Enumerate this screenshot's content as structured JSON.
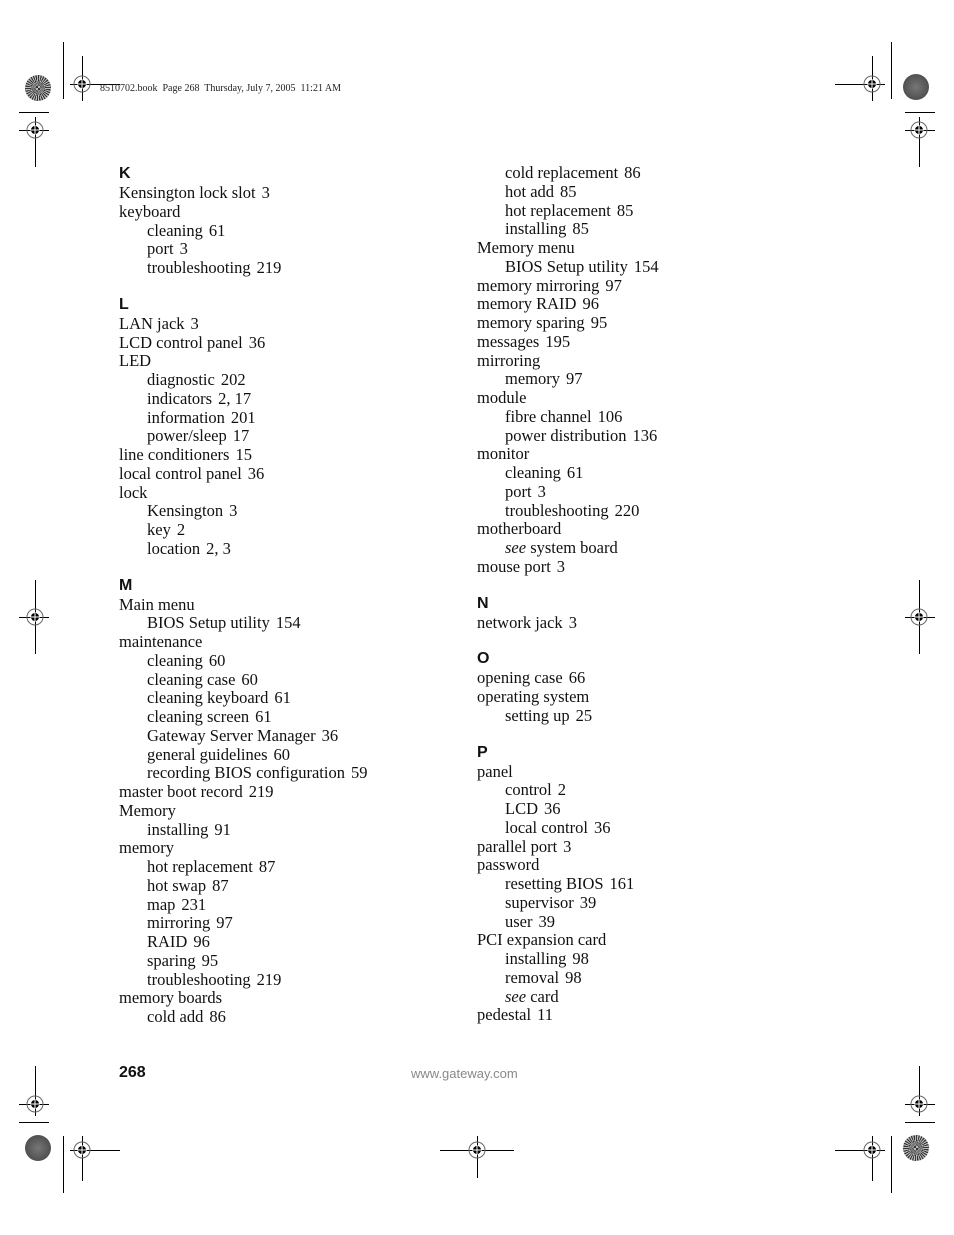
{
  "header": {
    "slug": "8510702.book  Page 268  Thursday, July 7, 2005  11:21 AM"
  },
  "left_column": [
    {
      "type": "letter",
      "text": "K"
    },
    {
      "type": "main",
      "text": "Kensington lock slot",
      "page": "3"
    },
    {
      "type": "main",
      "text": "keyboard",
      "page": ""
    },
    {
      "type": "sub",
      "text": "cleaning",
      "page": "61"
    },
    {
      "type": "sub",
      "text": "port",
      "page": "3"
    },
    {
      "type": "sub",
      "text": "troubleshooting",
      "page": "219"
    },
    {
      "type": "letter",
      "text": "L"
    },
    {
      "type": "main",
      "text": "LAN jack",
      "page": "3"
    },
    {
      "type": "main",
      "text": "LCD control panel",
      "page": "36"
    },
    {
      "type": "main",
      "text": "LED",
      "page": ""
    },
    {
      "type": "sub",
      "text": "diagnostic",
      "page": "202"
    },
    {
      "type": "sub",
      "text": "indicators",
      "page": "2, 17"
    },
    {
      "type": "sub",
      "text": "information",
      "page": "201"
    },
    {
      "type": "sub",
      "text": "power/sleep",
      "page": "17"
    },
    {
      "type": "main",
      "text": "line conditioners",
      "page": "15"
    },
    {
      "type": "main",
      "text": "local control panel",
      "page": "36"
    },
    {
      "type": "main",
      "text": "lock",
      "page": ""
    },
    {
      "type": "sub",
      "text": "Kensington",
      "page": "3"
    },
    {
      "type": "sub",
      "text": "key",
      "page": "2"
    },
    {
      "type": "sub",
      "text": "location",
      "page": "2, 3"
    },
    {
      "type": "letter",
      "text": "M"
    },
    {
      "type": "main",
      "text": "Main menu",
      "page": ""
    },
    {
      "type": "sub",
      "text": "BIOS Setup utility",
      "page": "154"
    },
    {
      "type": "main",
      "text": "maintenance",
      "page": ""
    },
    {
      "type": "sub",
      "text": "cleaning",
      "page": "60"
    },
    {
      "type": "sub",
      "text": "cleaning case",
      "page": "60"
    },
    {
      "type": "sub",
      "text": "cleaning keyboard",
      "page": "61"
    },
    {
      "type": "sub",
      "text": "cleaning screen",
      "page": "61"
    },
    {
      "type": "sub",
      "text": "Gateway Server Manager",
      "page": "36"
    },
    {
      "type": "sub",
      "text": "general guidelines",
      "page": "60"
    },
    {
      "type": "sub",
      "text": "recording BIOS configuration",
      "page": "59"
    },
    {
      "type": "main",
      "text": "master boot record",
      "page": "219"
    },
    {
      "type": "main",
      "text": "Memory",
      "page": ""
    },
    {
      "type": "sub",
      "text": "installing",
      "page": "91"
    },
    {
      "type": "main",
      "text": "memory",
      "page": ""
    },
    {
      "type": "sub",
      "text": "hot replacement",
      "page": "87"
    },
    {
      "type": "sub",
      "text": "hot swap",
      "page": "87"
    },
    {
      "type": "sub",
      "text": "map",
      "page": "231"
    },
    {
      "type": "sub",
      "text": "mirroring",
      "page": "97"
    },
    {
      "type": "sub",
      "text": "RAID",
      "page": "96"
    },
    {
      "type": "sub",
      "text": "sparing",
      "page": "95"
    },
    {
      "type": "sub",
      "text": "troubleshooting",
      "page": "219"
    },
    {
      "type": "main",
      "text": "memory boards",
      "page": ""
    },
    {
      "type": "sub",
      "text": "cold add",
      "page": "86"
    }
  ],
  "right_column": [
    {
      "type": "sub",
      "text": "cold replacement",
      "page": "86"
    },
    {
      "type": "sub",
      "text": "hot add",
      "page": "85"
    },
    {
      "type": "sub",
      "text": "hot replacement",
      "page": "85"
    },
    {
      "type": "sub",
      "text": "installing",
      "page": "85"
    },
    {
      "type": "main",
      "text": "Memory menu",
      "page": ""
    },
    {
      "type": "sub",
      "text": "BIOS Setup utility",
      "page": "154"
    },
    {
      "type": "main",
      "text": "memory mirroring",
      "page": "97"
    },
    {
      "type": "main",
      "text": "memory RAID",
      "page": "96"
    },
    {
      "type": "main",
      "text": "memory sparing",
      "page": "95"
    },
    {
      "type": "main",
      "text": "messages",
      "page": "195"
    },
    {
      "type": "main",
      "text": "mirroring",
      "page": ""
    },
    {
      "type": "sub",
      "text": "memory",
      "page": "97"
    },
    {
      "type": "main",
      "text": "module",
      "page": ""
    },
    {
      "type": "sub",
      "text": "fibre channel",
      "page": "106"
    },
    {
      "type": "sub",
      "text": "power distribution",
      "page": "136"
    },
    {
      "type": "main",
      "text": "monitor",
      "page": ""
    },
    {
      "type": "sub",
      "text": "cleaning",
      "page": "61"
    },
    {
      "type": "sub",
      "text": "port",
      "page": "3"
    },
    {
      "type": "sub",
      "text": "troubleshooting",
      "page": "220"
    },
    {
      "type": "main",
      "text": "motherboard",
      "page": ""
    },
    {
      "type": "sub",
      "see": "see",
      "text": "system board",
      "page": ""
    },
    {
      "type": "main",
      "text": "mouse port",
      "page": "3"
    },
    {
      "type": "letter",
      "text": "N"
    },
    {
      "type": "main",
      "text": "network jack",
      "page": "3"
    },
    {
      "type": "letter",
      "text": "O"
    },
    {
      "type": "main",
      "text": "opening case",
      "page": "66"
    },
    {
      "type": "main",
      "text": "operating system",
      "page": ""
    },
    {
      "type": "sub",
      "text": "setting up",
      "page": "25"
    },
    {
      "type": "letter",
      "text": "P"
    },
    {
      "type": "main",
      "text": "panel",
      "page": ""
    },
    {
      "type": "sub",
      "text": "control",
      "page": "2"
    },
    {
      "type": "sub",
      "text": "LCD",
      "page": "36"
    },
    {
      "type": "sub",
      "text": "local control",
      "page": "36"
    },
    {
      "type": "main",
      "text": "parallel port",
      "page": "3"
    },
    {
      "type": "main",
      "text": "password",
      "page": ""
    },
    {
      "type": "sub",
      "text": "resetting BIOS",
      "page": "161"
    },
    {
      "type": "sub",
      "text": "supervisor",
      "page": "39"
    },
    {
      "type": "sub",
      "text": "user",
      "page": "39"
    },
    {
      "type": "main",
      "text": "PCI expansion card",
      "page": ""
    },
    {
      "type": "sub",
      "text": "installing",
      "page": "98"
    },
    {
      "type": "sub",
      "text": "removal",
      "page": "98"
    },
    {
      "type": "sub",
      "see": "see",
      "text": "card",
      "page": ""
    },
    {
      "type": "main",
      "text": "pedestal",
      "page": "11"
    }
  ],
  "footer": {
    "page_number": "268",
    "url": "www.gateway.com"
  }
}
